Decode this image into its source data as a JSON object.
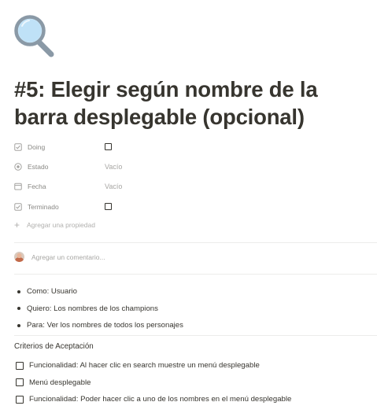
{
  "page": {
    "icon": "magnifying-glass-icon",
    "title": "#5: Elegir según nombre de la barra desplegable (opcional)"
  },
  "properties": [
    {
      "name": "Doing",
      "icon": "checkbox-property-icon",
      "type": "checkbox",
      "checked": false,
      "value": ""
    },
    {
      "name": "Estado",
      "icon": "status-property-icon",
      "type": "status",
      "value": "Vacío"
    },
    {
      "name": "Fecha",
      "icon": "calendar-property-icon",
      "type": "date",
      "value": "Vacío"
    },
    {
      "name": "Terminado",
      "icon": "checkbox-property-icon",
      "type": "checkbox",
      "checked": false,
      "value": ""
    }
  ],
  "add_property": {
    "label": "Agregar una propiedad"
  },
  "comment": {
    "placeholder": "Agregar un comentario..."
  },
  "bullets": [
    "Como: Usuario",
    "Quiero: Los nombres de los champions",
    "Para: Ver los nombres de todos los personajes"
  ],
  "acceptance": {
    "heading": "Criterios de Aceptación",
    "items": [
      {
        "label": "Funcionalidad: Al hacer clic en search muestre un menú desplegable",
        "checked": false
      },
      {
        "label": "Menú desplegable",
        "checked": false
      },
      {
        "label": "Funcionalidad: Poder hacer clic a uno de los nombres en el menú desplegable",
        "checked": false
      }
    ]
  },
  "colors": {
    "text": "#37352f",
    "muted": "#9b9a97",
    "divider": "#ececeb",
    "icon_lens": "#bfe1f7",
    "icon_handle": "#8a99a6"
  }
}
